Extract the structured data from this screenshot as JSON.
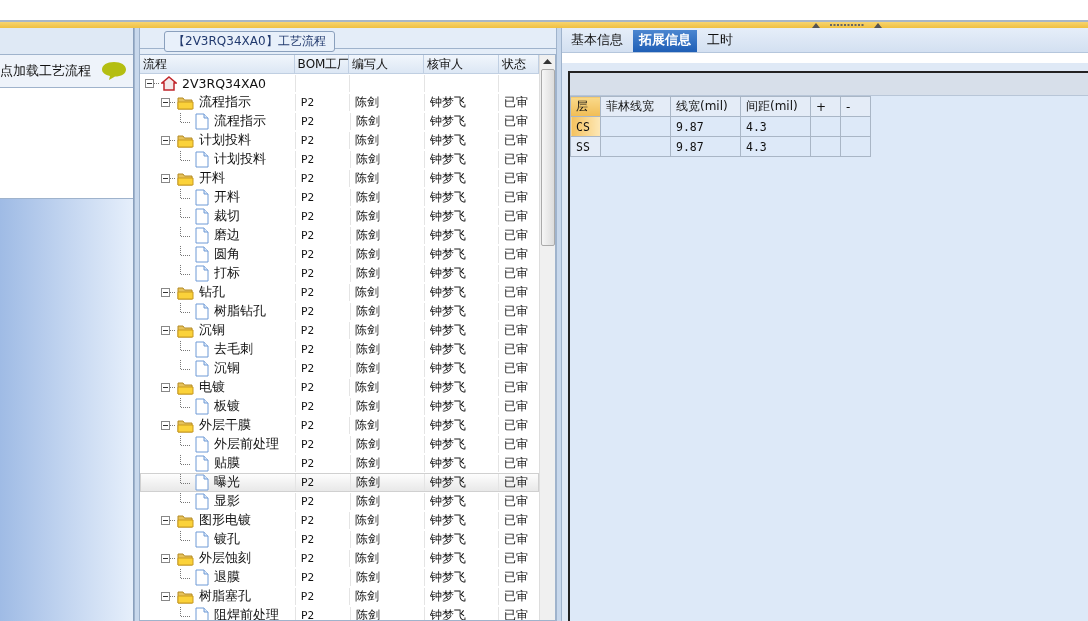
{
  "left_panel": {
    "title": "点加载工艺流程"
  },
  "flow_panel": {
    "caption": "【2V3RQ34XA0】工艺流程",
    "columns": [
      "流程",
      "BOM工厂",
      "编写人",
      "核审人",
      "状态"
    ],
    "tree": [
      {
        "kind": "root",
        "label": "2V3RQ34XA0",
        "expanded": true,
        "selected": false,
        "children": [
          {
            "kind": "folder",
            "label": "流程指示",
            "bom": "P2",
            "author": "陈剑",
            "reviewer": "钟梦飞",
            "status": "已审",
            "expanded": true,
            "selected": false,
            "children": [
              {
                "kind": "doc",
                "label": "流程指示",
                "bom": "P2",
                "author": "陈剑",
                "reviewer": "钟梦飞",
                "status": "已审",
                "selected": false
              }
            ]
          },
          {
            "kind": "folder",
            "label": "计划投料",
            "bom": "P2",
            "author": "陈剑",
            "reviewer": "钟梦飞",
            "status": "已审",
            "expanded": true,
            "selected": false,
            "children": [
              {
                "kind": "doc",
                "label": "计划投料",
                "bom": "P2",
                "author": "陈剑",
                "reviewer": "钟梦飞",
                "status": "已审",
                "selected": false
              }
            ]
          },
          {
            "kind": "folder",
            "label": "开料",
            "bom": "P2",
            "author": "陈剑",
            "reviewer": "钟梦飞",
            "status": "已审",
            "expanded": true,
            "selected": false,
            "children": [
              {
                "kind": "doc",
                "label": "开料",
                "bom": "P2",
                "author": "陈剑",
                "reviewer": "钟梦飞",
                "status": "已审",
                "selected": false
              },
              {
                "kind": "doc",
                "label": "裁切",
                "bom": "P2",
                "author": "陈剑",
                "reviewer": "钟梦飞",
                "status": "已审",
                "selected": false
              },
              {
                "kind": "doc",
                "label": "磨边",
                "bom": "P2",
                "author": "陈剑",
                "reviewer": "钟梦飞",
                "status": "已审",
                "selected": false
              },
              {
                "kind": "doc",
                "label": "圆角",
                "bom": "P2",
                "author": "陈剑",
                "reviewer": "钟梦飞",
                "status": "已审",
                "selected": false
              },
              {
                "kind": "doc",
                "label": "打标",
                "bom": "P2",
                "author": "陈剑",
                "reviewer": "钟梦飞",
                "status": "已审",
                "selected": false
              }
            ]
          },
          {
            "kind": "folder",
            "label": "钻孔",
            "bom": "P2",
            "author": "陈剑",
            "reviewer": "钟梦飞",
            "status": "已审",
            "expanded": true,
            "selected": false,
            "children": [
              {
                "kind": "doc",
                "label": "树脂钻孔",
                "bom": "P2",
                "author": "陈剑",
                "reviewer": "钟梦飞",
                "status": "已审",
                "selected": false
              }
            ]
          },
          {
            "kind": "folder",
            "label": "沉铜",
            "bom": "P2",
            "author": "陈剑",
            "reviewer": "钟梦飞",
            "status": "已审",
            "expanded": true,
            "selected": false,
            "children": [
              {
                "kind": "doc",
                "label": "去毛刺",
                "bom": "P2",
                "author": "陈剑",
                "reviewer": "钟梦飞",
                "status": "已审",
                "selected": false
              },
              {
                "kind": "doc",
                "label": "沉铜",
                "bom": "P2",
                "author": "陈剑",
                "reviewer": "钟梦飞",
                "status": "已审",
                "selected": false
              }
            ]
          },
          {
            "kind": "folder",
            "label": "电镀",
            "bom": "P2",
            "author": "陈剑",
            "reviewer": "钟梦飞",
            "status": "已审",
            "expanded": true,
            "selected": false,
            "children": [
              {
                "kind": "doc",
                "label": "板镀",
                "bom": "P2",
                "author": "陈剑",
                "reviewer": "钟梦飞",
                "status": "已审",
                "selected": false
              }
            ]
          },
          {
            "kind": "folder",
            "label": "外层干膜",
            "bom": "P2",
            "author": "陈剑",
            "reviewer": "钟梦飞",
            "status": "已审",
            "expanded": true,
            "selected": false,
            "children": [
              {
                "kind": "doc",
                "label": "外层前处理",
                "bom": "P2",
                "author": "陈剑",
                "reviewer": "钟梦飞",
                "status": "已审",
                "selected": false
              },
              {
                "kind": "doc",
                "label": "贴膜",
                "bom": "P2",
                "author": "陈剑",
                "reviewer": "钟梦飞",
                "status": "已审",
                "selected": false
              },
              {
                "kind": "doc",
                "label": "曝光",
                "bom": "P2",
                "author": "陈剑",
                "reviewer": "钟梦飞",
                "status": "已审",
                "selected": true
              },
              {
                "kind": "doc",
                "label": "显影",
                "bom": "P2",
                "author": "陈剑",
                "reviewer": "钟梦飞",
                "status": "已审",
                "selected": false
              }
            ]
          },
          {
            "kind": "folder",
            "label": "图形电镀",
            "bom": "P2",
            "author": "陈剑",
            "reviewer": "钟梦飞",
            "status": "已审",
            "expanded": true,
            "selected": false,
            "children": [
              {
                "kind": "doc",
                "label": "镀孔",
                "bom": "P2",
                "author": "陈剑",
                "reviewer": "钟梦飞",
                "status": "已审",
                "selected": false
              }
            ]
          },
          {
            "kind": "folder",
            "label": "外层蚀刻",
            "bom": "P2",
            "author": "陈剑",
            "reviewer": "钟梦飞",
            "status": "已审",
            "expanded": true,
            "selected": false,
            "children": [
              {
                "kind": "doc",
                "label": "退膜",
                "bom": "P2",
                "author": "陈剑",
                "reviewer": "钟梦飞",
                "status": "已审",
                "selected": false
              }
            ]
          },
          {
            "kind": "folder",
            "label": "树脂塞孔",
            "bom": "P2",
            "author": "陈剑",
            "reviewer": "钟梦飞",
            "status": "已审",
            "expanded": true,
            "selected": false,
            "children": [
              {
                "kind": "doc",
                "label": "阻焊前处理",
                "bom": "P2",
                "author": "陈剑",
                "reviewer": "钟梦飞",
                "status": "已审",
                "selected": false
              }
            ]
          }
        ]
      }
    ]
  },
  "detail_panel": {
    "tabs": [
      {
        "label": "基本信息",
        "selected": false
      },
      {
        "label": "拓展信息",
        "selected": true
      },
      {
        "label": "工时",
        "selected": false
      }
    ],
    "table": {
      "columns": [
        "层",
        "菲林线宽",
        "线宽(mil)",
        "间距(mil)",
        "+",
        "-"
      ],
      "rows": [
        {
          "selected": true,
          "cells": [
            "CS",
            "",
            "9.87",
            "4.3",
            "",
            ""
          ]
        },
        {
          "selected": false,
          "cells": [
            "SS",
            "",
            "9.87",
            "4.3",
            "",
            ""
          ]
        }
      ]
    }
  }
}
